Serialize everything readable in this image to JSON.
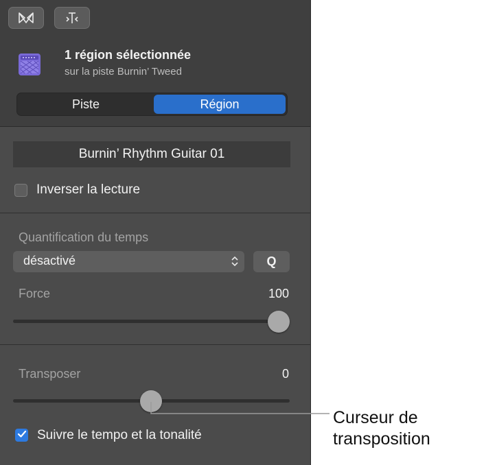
{
  "toolbar": {
    "buttons": [
      {
        "icon": "library-icon"
      },
      {
        "icon": "smart-controls-icon"
      }
    ]
  },
  "header": {
    "icon": "amp-icon",
    "title": "1 région sélectionnée",
    "subtitle": "sur la piste Burnin’ Tweed"
  },
  "tabs": [
    {
      "label": "Piste",
      "selected": false
    },
    {
      "label": "Région",
      "selected": true
    }
  ],
  "region": {
    "name": "Burnin’ Rhythm Guitar 01",
    "reverse_label": "Inverser la lecture",
    "reverse_checked": false
  },
  "quantize": {
    "label": "Quantification du temps",
    "value": "désactivé",
    "q_button": "Q",
    "strength_label": "Force",
    "strength_value": "100"
  },
  "transpose": {
    "label": "Transposer",
    "value": "0",
    "follow_label": "Suivre le tempo et la tonalité",
    "follow_checked": true
  },
  "callout": {
    "line1": "Curseur de",
    "line2": "transposition"
  },
  "colors": {
    "accent": "#2a6fcb",
    "panel": "#4b4b4b",
    "checkbox_on": "#2d7ae0"
  }
}
